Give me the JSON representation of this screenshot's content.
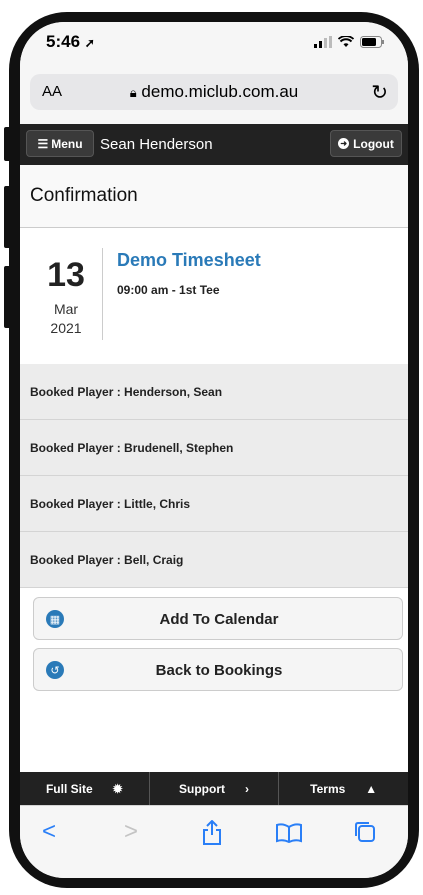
{
  "status": {
    "time": "5:46"
  },
  "address_bar": {
    "text_size_label": "AA",
    "url": "demo.miclub.com.au"
  },
  "header": {
    "menu_label": "Menu",
    "user_name": "Sean Henderson",
    "logout_label": "Logout"
  },
  "page": {
    "title": "Confirmation"
  },
  "event": {
    "day": "13",
    "month": "Mar",
    "year": "2021",
    "title": "Demo Timesheet",
    "time_tee": "09:00 am - 1st Tee"
  },
  "players": [
    "Booked Player : Henderson, Sean",
    "Booked Player : Brudenell, Stephen",
    "Booked Player : Little, Chris",
    "Booked Player : Bell, Craig"
  ],
  "actions": {
    "add_to_calendar": "Add To Calendar",
    "back_to_bookings": "Back to Bookings"
  },
  "footer": {
    "full_site": "Full Site",
    "support": "Support",
    "terms": "Terms"
  },
  "colors": {
    "accent": "#2a7ab8",
    "header_bg": "#222222",
    "safari_blue": "#2a7ff7"
  }
}
